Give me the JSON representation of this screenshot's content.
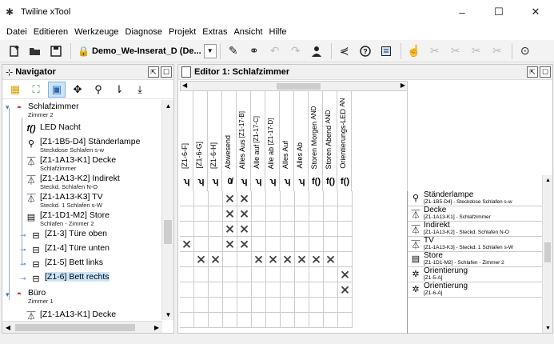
{
  "window": {
    "title": "Twiline xTool",
    "minimize": "–",
    "maximize": "☐",
    "close": "✕"
  },
  "menu": [
    "Datei",
    "Editieren",
    "Werkzeuge",
    "Diagnose",
    "Projekt",
    "Extras",
    "Ansicht",
    "Hilfe"
  ],
  "toolbar": {
    "project_name": "Demo_We-Inserat_D (De..."
  },
  "navigator": {
    "title": "Navigator",
    "tree": [
      {
        "main": "Schlafzimmer",
        "sub": "Zimmer 2",
        "icon": "room-icon"
      },
      {
        "main": "LED Nacht",
        "sub": "",
        "icon": "function-icon"
      },
      {
        "main": "[Z1-1B5-D4] Ständerlampe",
        "sub": "Steckdose Schlafen s-w",
        "icon": "lamp-icon"
      },
      {
        "main": "[Z1-1A13-K1] Decke",
        "sub": "Schlafzimmer",
        "icon": "ceiling-light-icon"
      },
      {
        "main": "[Z1-1A13-K2] Indirekt",
        "sub": "Steckd. Schlafen N-O",
        "icon": "ceiling-light-icon"
      },
      {
        "main": "[Z1-1A13-K3] TV",
        "sub": "Steckd. 1 Schlafen s-W",
        "icon": "ceiling-light-icon"
      },
      {
        "main": "[Z1-1D1-M2] Store",
        "sub": "Schlafen - Zimmer 2",
        "icon": "blind-icon"
      },
      {
        "main": "[Z1-3] Türe oben",
        "sub": "",
        "icon": "button-icon"
      },
      {
        "main": "[Z1-4] Türe unten",
        "sub": "",
        "icon": "button-icon"
      },
      {
        "main": "[Z1-5] Bett links",
        "sub": "",
        "icon": "button-icon"
      },
      {
        "main": "[Z1-6] Bett rechts",
        "sub": "",
        "icon": "button-icon"
      },
      {
        "main": "Büro",
        "sub": "Zimmer 1",
        "icon": "room-icon"
      },
      {
        "main": "[Z1-1A13-K1] Decke",
        "sub": "",
        "icon": "ceiling-light-icon"
      }
    ]
  },
  "editor": {
    "title": "Editor 1: Schlafzimmer",
    "columns": [
      {
        "label": "[Z1-6-F]",
        "sub": "",
        "icon": "ʮ"
      },
      {
        "label": "[Z1-6-G]",
        "sub": "",
        "icon": "ʮ"
      },
      {
        "label": "[Z1-6-H]",
        "sub": "",
        "icon": "ʮ"
      },
      {
        "label": "Abwesend",
        "sub": "",
        "icon": "0̸"
      },
      {
        "label": "Alles Aus",
        "sub": "[Z1-17-B]",
        "icon": "ʮ"
      },
      {
        "label": "Alle auf",
        "sub": "[Z1-17-C]",
        "icon": "ʮ"
      },
      {
        "label": "Alle ab",
        "sub": "[Z1-17-D]",
        "icon": "ʮ"
      },
      {
        "label": "Alles Auf",
        "sub": "",
        "icon": "ʮ"
      },
      {
        "label": "Alles Ab",
        "sub": "",
        "icon": "ʮ"
      },
      {
        "label": "Storen Morgen",
        "sub": "AND",
        "icon": "f()"
      },
      {
        "label": "Storen Abend",
        "sub": "AND",
        "icon": "f()"
      },
      {
        "label": "Orientierungs-LED",
        "sub": "AN",
        "icon": "f()"
      }
    ],
    "rows": [
      {
        "main": "Ständerlampe",
        "sub": "[Z1-1B5-D4] - Steckdose Schlafen s-w",
        "icon": "lamp-icon",
        "marks": [
          3,
          4
        ]
      },
      {
        "main": "Decke",
        "sub": "[Z1-1A13-K1] - Schlafzimmer",
        "icon": "ceiling-light-icon",
        "marks": [
          3,
          4
        ]
      },
      {
        "main": "Indirekt",
        "sub": "[Z1-1A13-K2] - Steckd. Schlafen N-O",
        "icon": "ceiling-light-icon",
        "marks": [
          3,
          4
        ]
      },
      {
        "main": "TV",
        "sub": "[Z1-1A13-K3] - Steckd. 1 Schlafen s-W",
        "icon": "ceiling-light-icon",
        "marks": [
          0,
          3,
          4
        ]
      },
      {
        "main": "Store",
        "sub": "[Z1-1D1-M2] - Schlafen - Zimmer 2",
        "icon": "blind-icon",
        "marks": [
          1,
          2,
          5,
          6,
          7,
          8,
          9,
          10
        ]
      },
      {
        "main": "Orientierung",
        "sub": "[Z1-5-A]",
        "icon": "led-icon",
        "marks": [
          11
        ]
      },
      {
        "main": "Orientierung",
        "sub": "[Z1-6-A]",
        "icon": "led-icon",
        "marks": [
          11
        ]
      }
    ]
  }
}
